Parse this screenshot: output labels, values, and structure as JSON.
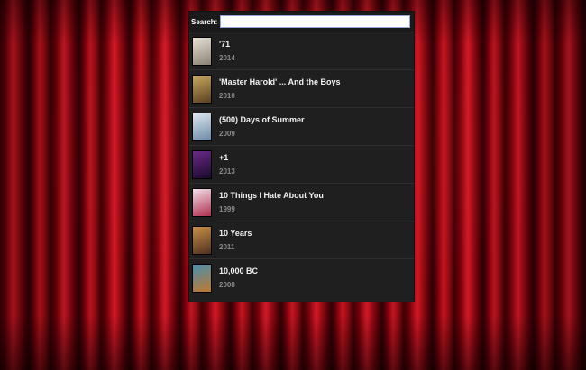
{
  "search": {
    "label": "Search:",
    "value": "",
    "placeholder": ""
  },
  "movies": [
    {
      "title": "'71",
      "year": "2014",
      "poster_colors": [
        "#e8e2d5",
        "#8a8172"
      ]
    },
    {
      "title": "'Master Harold' ... And the Boys",
      "year": "2010",
      "poster_colors": [
        "#c8a860",
        "#5a4020"
      ]
    },
    {
      "title": "(500) Days of Summer",
      "year": "2009",
      "poster_colors": [
        "#dfe8ef",
        "#6a8aa8"
      ]
    },
    {
      "title": "+1",
      "year": "2013",
      "poster_colors": [
        "#6a2a8a",
        "#1a0a2a"
      ]
    },
    {
      "title": "10 Things I Hate About You",
      "year": "1999",
      "poster_colors": [
        "#f0e0e8",
        "#b03050"
      ]
    },
    {
      "title": "10 Years",
      "year": "2011",
      "poster_colors": [
        "#c89048",
        "#503020"
      ]
    },
    {
      "title": "10,000 BC",
      "year": "2008",
      "poster_colors": [
        "#4a90b0",
        "#c07830"
      ]
    }
  ]
}
